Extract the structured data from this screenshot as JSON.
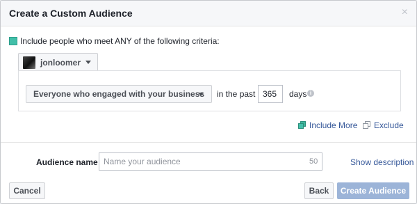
{
  "dialog": {
    "title": "Create a Custom Audience",
    "close_glyph": "×"
  },
  "criteria": {
    "text": "Include people who meet ANY of the following criteria:"
  },
  "page_selector": {
    "name": "jonloomer"
  },
  "rule": {
    "engagement_option": "Everyone who engaged with your business",
    "in_the_past_label": "in the past",
    "days_value": "365",
    "days_label": "days",
    "info_glyph": "i"
  },
  "actions": {
    "include_more": "Include More",
    "exclude": "Exclude"
  },
  "audience_name": {
    "label": "Audience name",
    "placeholder": "Name your audience",
    "char_limit": "50",
    "show_description": "Show description"
  },
  "footer": {
    "cancel": "Cancel",
    "back": "Back",
    "create": "Create Audience"
  },
  "colors": {
    "teal_accent": "#42bfa9",
    "link_blue": "#365899",
    "create_button_disabled": "#9cb4d8"
  }
}
